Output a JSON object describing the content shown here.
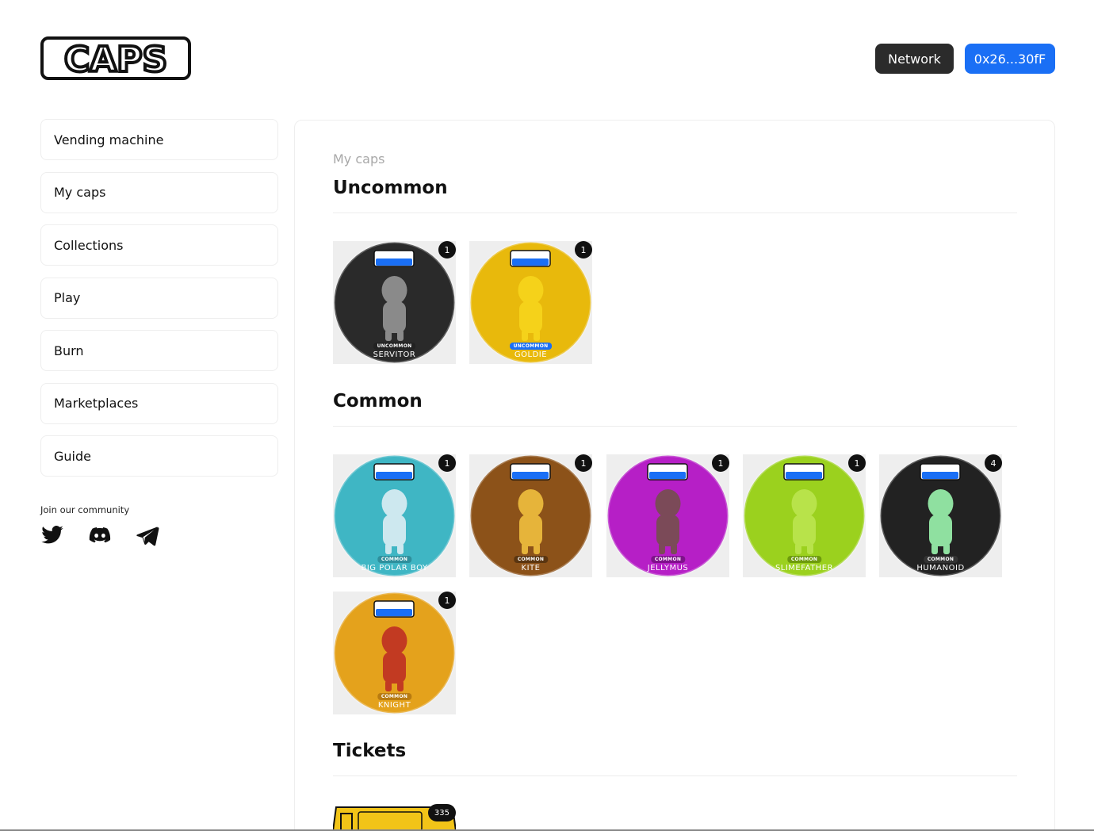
{
  "header": {
    "logo_text": "CAPS",
    "network_label": "Network",
    "wallet_label": "0x26...30fF",
    "wallet_color": "#1a6ff5"
  },
  "sidebar": {
    "items": [
      {
        "label": "Vending machine"
      },
      {
        "label": "My caps"
      },
      {
        "label": "Collections"
      },
      {
        "label": "Play"
      },
      {
        "label": "Burn"
      },
      {
        "label": "Marketplaces"
      },
      {
        "label": "Guide"
      }
    ],
    "community_label": "Join our community",
    "socials": [
      "twitter-icon",
      "discord-icon",
      "telegram-icon"
    ]
  },
  "main": {
    "breadcrumb": "My caps",
    "sections": [
      {
        "title": "Uncommon",
        "caps": [
          {
            "name": "SERVITOR",
            "rarity": "UNCOMMON",
            "count": "1",
            "color": "#2a2a2a",
            "figure": "#8a8a8a",
            "tag_color": "#222"
          },
          {
            "name": "GOLDIE",
            "rarity": "UNCOMMON",
            "count": "1",
            "color": "#e8b90c",
            "figure": "#f5d21a",
            "tag_color": "#1a6ff5"
          }
        ]
      },
      {
        "title": "Common",
        "caps": [
          {
            "name": "BIG POLAR BOY",
            "rarity": "COMMON",
            "count": "1",
            "color": "#3fb6c4",
            "figure": "#cde8ef",
            "tag_color": "#2f8f9c"
          },
          {
            "name": "KITE",
            "rarity": "COMMON",
            "count": "1",
            "color": "#8c5219",
            "figure": "#e6b43a",
            "tag_color": "#5a3510"
          },
          {
            "name": "JELLYMUS",
            "rarity": "COMMON",
            "count": "1",
            "color": "#b61fc6",
            "figure": "#7b4a58",
            "tag_color": "#7e128a"
          },
          {
            "name": "SLIMEFATHER",
            "rarity": "COMMON",
            "count": "1",
            "color": "#9bd11e",
            "figure": "#b8e34a",
            "tag_color": "#6d9a0d"
          },
          {
            "name": "HUMANOID",
            "rarity": "COMMON",
            "count": "4",
            "color": "#222222",
            "figure": "#8fe0a0",
            "tag_color": "#333"
          },
          {
            "name": "KNIGHT",
            "rarity": "COMMON",
            "count": "1",
            "color": "#e4a21c",
            "figure": "#c23a22",
            "tag_color": "#b87b10"
          }
        ]
      },
      {
        "title": "Tickets",
        "tickets": [
          {
            "count": "335",
            "color": "#f2c418"
          }
        ]
      }
    ]
  }
}
